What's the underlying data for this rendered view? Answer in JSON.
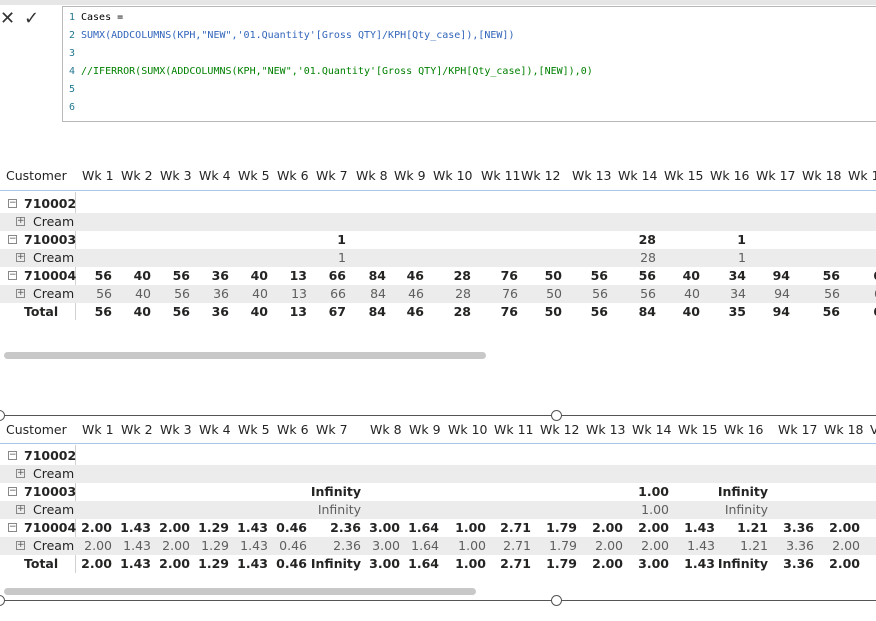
{
  "formula_bar": {
    "cancel_icon": "x-icon",
    "commit_icon": "check-icon",
    "line_numbers": [
      "1",
      "2",
      "3",
      "4",
      "5",
      "6"
    ],
    "line1": "Cases =",
    "line2": "SUMX(ADDCOLUMNS(KPH,\"NEW\",'01.Quantity'[Gross QTY]/KPH[Qty_case]),[NEW])",
    "line4": "//IFERROR(SUMX(ADDCOLUMNS(KPH,\"NEW\",'01.Quantity'[Gross QTY]/KPH[Qty_case]),[NEW]),0)"
  },
  "matrix1": {
    "headers": [
      "Customer",
      "Wk 1",
      "Wk 2",
      "Wk 3",
      "Wk 4",
      "Wk 5",
      "Wk 6",
      "Wk 7",
      "Wk 8",
      "Wk 9",
      "Wk 10",
      "Wk 11",
      "Wk 12",
      "Wk 13",
      "Wk 14",
      "Wk 15",
      "Wk 16",
      "Wk 17",
      "Wk 18",
      "Wk 1"
    ],
    "rows": [
      {
        "label": "710002",
        "bold": true,
        "expander": "⊟",
        "values": [
          "",
          "",
          "",
          "",
          "",
          "",
          "",
          "",
          "",
          "",
          "",
          "",
          "",
          "",
          "",
          "",
          "",
          "",
          ""
        ]
      },
      {
        "label": "Cream",
        "bold": false,
        "expander": "⊞",
        "values": [
          "",
          "",
          "",
          "",
          "",
          "",
          "",
          "",
          "",
          "",
          "",
          "",
          "",
          "",
          "",
          "",
          "",
          "",
          ""
        ]
      },
      {
        "label": "710003",
        "bold": true,
        "expander": "⊟",
        "values": [
          "",
          "",
          "",
          "",
          "",
          "",
          "1",
          "",
          "",
          "",
          "",
          "",
          "",
          "28",
          "",
          "1",
          "",
          "",
          ""
        ]
      },
      {
        "label": "Cream",
        "bold": false,
        "expander": "⊞",
        "values": [
          "",
          "",
          "",
          "",
          "",
          "",
          "1",
          "",
          "",
          "",
          "",
          "",
          "",
          "28",
          "",
          "1",
          "",
          "",
          ""
        ]
      },
      {
        "label": "710004",
        "bold": true,
        "expander": "⊟",
        "values": [
          "56",
          "40",
          "56",
          "36",
          "40",
          "13",
          "66",
          "84",
          "46",
          "28",
          "76",
          "50",
          "56",
          "56",
          "40",
          "34",
          "94",
          "56",
          "6"
        ]
      },
      {
        "label": "Cream",
        "bold": false,
        "expander": "⊞",
        "values": [
          "56",
          "40",
          "56",
          "36",
          "40",
          "13",
          "66",
          "84",
          "46",
          "28",
          "76",
          "50",
          "56",
          "56",
          "40",
          "34",
          "94",
          "56",
          "6"
        ]
      },
      {
        "label": "Total",
        "bold": true,
        "expander": "",
        "values": [
          "56",
          "40",
          "56",
          "36",
          "40",
          "13",
          "67",
          "84",
          "46",
          "28",
          "76",
          "50",
          "56",
          "84",
          "40",
          "35",
          "94",
          "56",
          "6"
        ]
      }
    ]
  },
  "matrix2": {
    "headers": [
      "Customer",
      "Wk 1",
      "Wk 2",
      "Wk 3",
      "Wk 4",
      "Wk 5",
      "Wk 6",
      "Wk 7",
      "Wk 8",
      "Wk 9",
      "Wk 10",
      "Wk 11",
      "Wk 12",
      "Wk 13",
      "Wk 14",
      "Wk 15",
      "Wk 16",
      "Wk 17",
      "Wk 18",
      "V"
    ],
    "rows": [
      {
        "label": "710002",
        "bold": true,
        "expander": "⊟",
        "values": [
          "",
          "",
          "",
          "",
          "",
          "",
          "",
          "",
          "",
          "",
          "",
          "",
          "",
          "",
          "",
          "",
          "",
          "",
          ""
        ]
      },
      {
        "label": "Cream",
        "bold": false,
        "expander": "⊞",
        "values": [
          "",
          "",
          "",
          "",
          "",
          "",
          "",
          "",
          "",
          "",
          "",
          "",
          "",
          "",
          "",
          "",
          "",
          "",
          ""
        ]
      },
      {
        "label": "710003",
        "bold": true,
        "expander": "⊟",
        "values": [
          "",
          "",
          "",
          "",
          "",
          "",
          "Infinity",
          "",
          "",
          "",
          "",
          "",
          "",
          "1.00",
          "",
          "Infinity",
          "",
          "",
          ""
        ]
      },
      {
        "label": "Cream",
        "bold": false,
        "expander": "⊞",
        "values": [
          "",
          "",
          "",
          "",
          "",
          "",
          "Infinity",
          "",
          "",
          "",
          "",
          "",
          "",
          "1.00",
          "",
          "Infinity",
          "",
          "",
          ""
        ]
      },
      {
        "label": "710004",
        "bold": true,
        "expander": "⊟",
        "values": [
          "2.00",
          "1.43",
          "2.00",
          "1.29",
          "1.43",
          "0.46",
          "2.36",
          "3.00",
          "1.64",
          "1.00",
          "2.71",
          "1.79",
          "2.00",
          "2.00",
          "1.43",
          "1.21",
          "3.36",
          "2.00",
          ""
        ]
      },
      {
        "label": "Cream",
        "bold": false,
        "expander": "⊞",
        "values": [
          "2.00",
          "1.43",
          "2.00",
          "1.29",
          "1.43",
          "0.46",
          "2.36",
          "3.00",
          "1.64",
          "1.00",
          "2.71",
          "1.79",
          "2.00",
          "2.00",
          "1.43",
          "1.21",
          "3.36",
          "2.00",
          ""
        ]
      },
      {
        "label": "Total",
        "bold": true,
        "expander": "",
        "values": [
          "2.00",
          "1.43",
          "2.00",
          "1.29",
          "1.43",
          "0.46",
          "Infinity",
          "3.00",
          "1.64",
          "1.00",
          "2.71",
          "1.79",
          "2.00",
          "3.00",
          "1.43",
          "Infinity",
          "3.36",
          "2.00",
          ""
        ]
      }
    ]
  }
}
